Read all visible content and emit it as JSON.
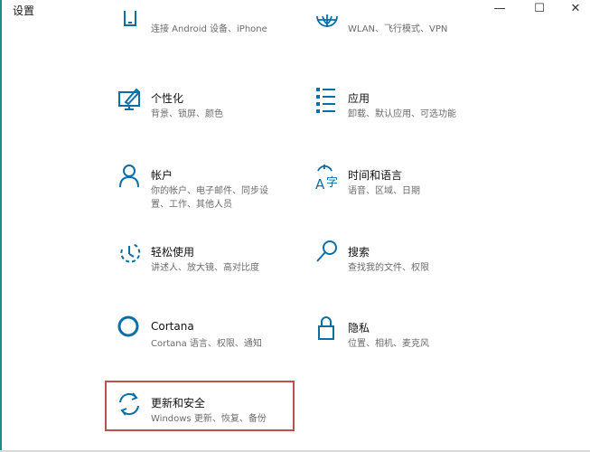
{
  "window": {
    "title": "设置",
    "controls": {
      "minimize": "—",
      "maximize": "☐",
      "close": "✕"
    }
  },
  "colors": {
    "accent": "#0a6fa7",
    "edge": "#1c8a8e",
    "highlight": "#c0504d"
  },
  "tiles": [
    {
      "name": "",
      "desc": "连接 Android 设备、iPhone",
      "icon": "phone-icon"
    },
    {
      "name": "",
      "desc": "WLAN、飞行模式、VPN",
      "icon": "globe-icon"
    },
    {
      "name": "个性化",
      "desc": "背景、锁屏、颜色",
      "icon": "paintbrush-icon"
    },
    {
      "name": "应用",
      "desc": "卸载、默认应用、可选功能",
      "icon": "apps-list-icon"
    },
    {
      "name": "帐户",
      "desc": "你的帐户、电子邮件、同步设",
      "desc2": "置、工作、其他人员",
      "icon": "person-icon"
    },
    {
      "name": "时间和语言",
      "desc": "语音、区域、日期",
      "icon": "time-language-icon"
    },
    {
      "name": "轻松使用",
      "desc": "讲述人、放大镜、高对比度",
      "icon": "ease-of-access-icon"
    },
    {
      "name": "搜索",
      "desc": "查找我的文件、权限",
      "icon": "search-icon"
    },
    {
      "name": "Cortana",
      "desc": "Cortana 语言、权限、通知",
      "icon": "cortana-icon"
    },
    {
      "name": "隐私",
      "desc": "位置、相机、麦克风",
      "icon": "lock-icon"
    },
    {
      "name": "更新和安全",
      "desc": "Windows 更新、恢复、备份",
      "icon": "update-sync-icon"
    }
  ]
}
